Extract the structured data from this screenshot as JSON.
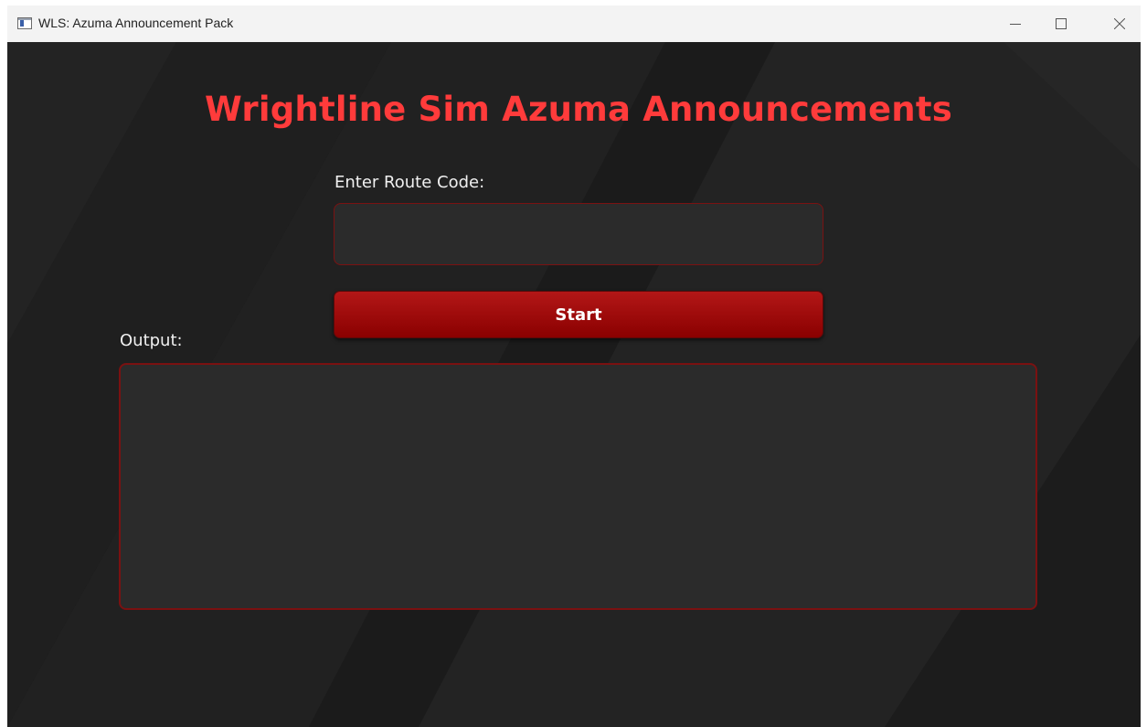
{
  "window": {
    "title": "WLS: Azuma Announcement Pack",
    "icon": "app-window-icon",
    "controls": [
      "minimize-icon",
      "maximize-icon",
      "close-icon"
    ]
  },
  "main": {
    "heading": "Wrightline Sim Azuma Announcements",
    "route_label": "Enter Route Code:",
    "route_value": "",
    "route_placeholder": "",
    "start_label": "Start",
    "output_label": "Output:",
    "output_value": ""
  },
  "colors": {
    "background": "#1d1d1d",
    "accent": "#ff3b3b",
    "button": "#a00d0d",
    "field": "#2b2b2b",
    "field_border": "#7a1212"
  }
}
